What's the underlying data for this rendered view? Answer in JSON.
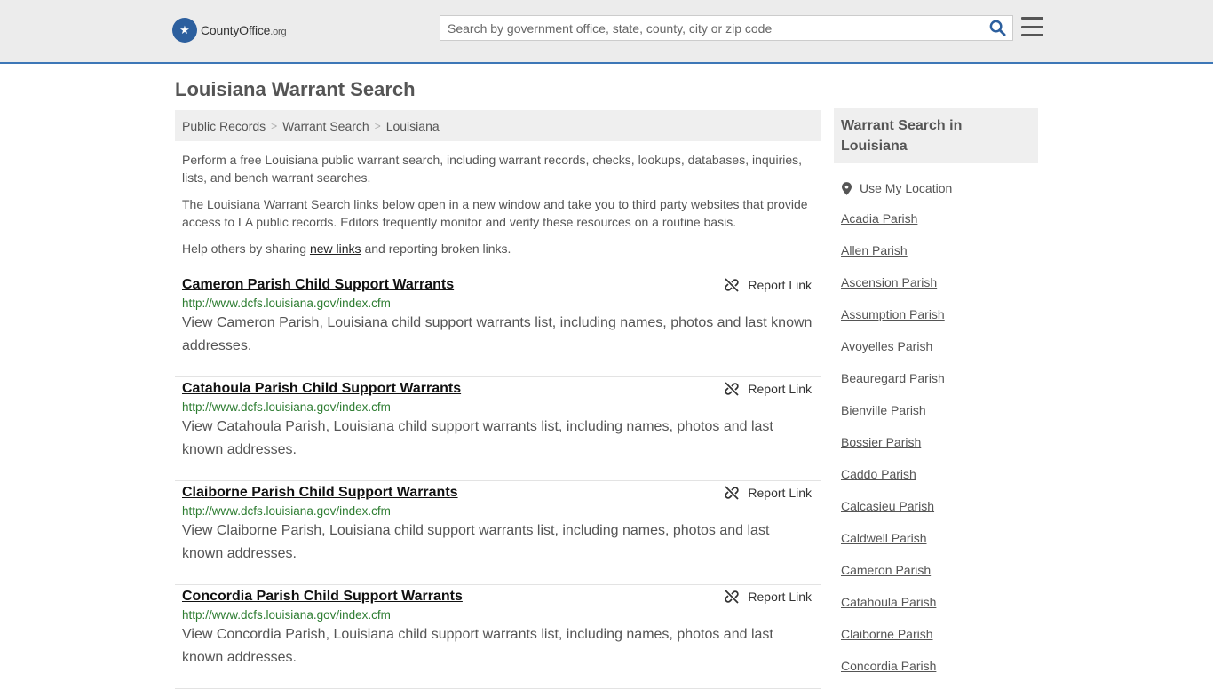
{
  "header": {
    "logo_brand": "CountyOffice",
    "logo_tld": ".org",
    "search_placeholder": "Search by government office, state, county, city or zip code"
  },
  "page_title": "Louisiana Warrant Search",
  "breadcrumb": [
    "Public Records",
    "Warrant Search",
    "Louisiana"
  ],
  "intro": {
    "p1": "Perform a free Louisiana public warrant search, including warrant records, checks, lookups, databases, inquiries, lists, and bench warrant searches.",
    "p2": "The Louisiana Warrant Search links below open in a new window and take you to third party websites that provide access to LA public records. Editors frequently monitor and verify these resources on a routine basis.",
    "p3_before": "Help others by sharing ",
    "p3_link": "new links",
    "p3_after": " and reporting broken links."
  },
  "report_label": "Report Link",
  "results": [
    {
      "title": "Cameron Parish Child Support Warrants",
      "url": "http://www.dcfs.louisiana.gov/index.cfm",
      "desc": "View Cameron Parish, Louisiana child support warrants list, including names, photos and last known addresses."
    },
    {
      "title": "Catahoula Parish Child Support Warrants",
      "url": "http://www.dcfs.louisiana.gov/index.cfm",
      "desc": "View Catahoula Parish, Louisiana child support warrants list, including names, photos and last known addresses."
    },
    {
      "title": "Claiborne Parish Child Support Warrants",
      "url": "http://www.dcfs.louisiana.gov/index.cfm",
      "desc": "View Claiborne Parish, Louisiana child support warrants list, including names, photos and last known addresses."
    },
    {
      "title": "Concordia Parish Child Support Warrants",
      "url": "http://www.dcfs.louisiana.gov/index.cfm",
      "desc": "View Concordia Parish, Louisiana child support warrants list, including names, photos and last known addresses."
    }
  ],
  "sidebar": {
    "title": "Warrant Search in Louisiana",
    "use_location": "Use My Location",
    "parishes": [
      "Acadia Parish",
      "Allen Parish",
      "Ascension Parish",
      "Assumption Parish",
      "Avoyelles Parish",
      "Beauregard Parish",
      "Bienville Parish",
      "Bossier Parish",
      "Caddo Parish",
      "Calcasieu Parish",
      "Caldwell Parish",
      "Cameron Parish",
      "Catahoula Parish",
      "Claiborne Parish",
      "Concordia Parish"
    ]
  },
  "colors": {
    "header_bg": "#ececec",
    "header_border": "#3d77b7",
    "url_green": "#2e7d32",
    "search_icon": "#2c5f9e"
  },
  "icons": [
    "seal-logo-icon",
    "search-icon",
    "menu-icon",
    "broken-link-icon",
    "location-pin-icon"
  ]
}
